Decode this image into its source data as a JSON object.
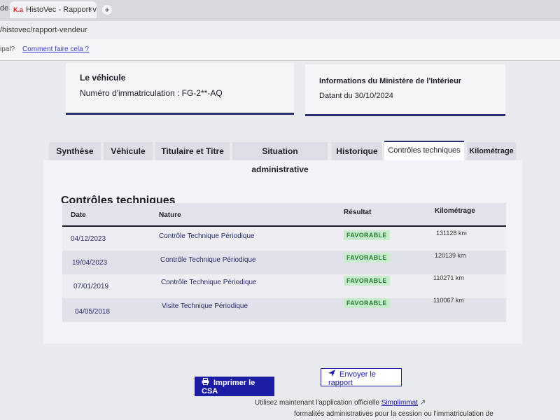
{
  "browser": {
    "tab_edge": "de",
    "tab_title": "HistoVec - Rapport vendeur",
    "url": "/histovec/rapport-vendeur"
  },
  "hintbar": {
    "cut_text": "ipal?",
    "link": "Comment faire cela ?"
  },
  "vehicle": {
    "title": "Le véhicule",
    "line": "Numéro d'immatriculation : FG-2**-AQ"
  },
  "ministry": {
    "title": "Informations du Ministère de l'Intérieur",
    "line": "Datant du 30/10/2024"
  },
  "tabs": [
    {
      "label": "Synthèse"
    },
    {
      "label": "Véhicule"
    },
    {
      "label": "Titulaire et Titre"
    },
    {
      "label": "Situation administrative"
    },
    {
      "label": "Historique"
    },
    {
      "label": "Contrôles techniques"
    },
    {
      "label": "Kilométrage"
    }
  ],
  "section": {
    "title": "Contrôles techniques",
    "headers": {
      "date": "Date",
      "nature": "Nature",
      "resultat": "Résultat",
      "km": "Kilométrage"
    },
    "rows": [
      {
        "date": "04/12/2023",
        "nature": "Contrôle Technique Périodique",
        "result": "FAVORABLE",
        "km": "131128 km"
      },
      {
        "date": "19/04/2023",
        "nature": "Contrôle Technique Périodique",
        "result": "FAVORABLE",
        "km": "120139 km"
      },
      {
        "date": "07/01/2019",
        "nature": "Contrôle Technique Périodique",
        "result": "FAVORABLE",
        "km": "110271 km"
      },
      {
        "date": "04/05/2018",
        "nature": "Visite Technique Périodique",
        "result": "FAVORABLE",
        "km": "110067 km"
      }
    ]
  },
  "actions": {
    "print": "Imprimer le CSA",
    "send": "Envoyer le rapport"
  },
  "footer": {
    "line1_before": "Utilisez maintenant l'application officielle",
    "line1_link": "Simplimmat",
    "line2": "formalités administratives pour la cession ou l'immatriculation de"
  },
  "colors": {
    "accent": "#1d1ca5",
    "badge_bg": "#c7eccb",
    "badge_text": "#2b7a3b"
  }
}
